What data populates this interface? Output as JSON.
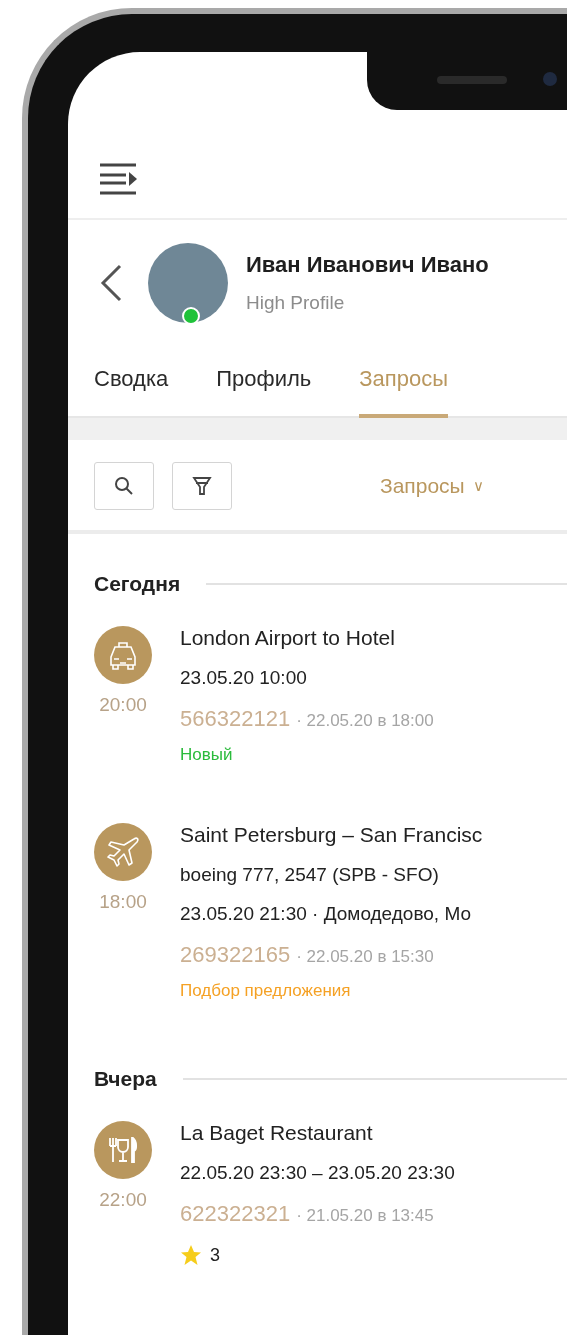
{
  "profile": {
    "name": "Иван Иванович Ивано",
    "subtitle": "High Profile",
    "online": true
  },
  "tabs": [
    {
      "label": "Сводка",
      "selected": false
    },
    {
      "label": "Профиль",
      "selected": false
    },
    {
      "label": "Запросы",
      "selected": true
    }
  ],
  "toolbar": {
    "filter_label": "Запросы",
    "caret": "∨"
  },
  "sections": [
    {
      "title": "Сегодня",
      "items": [
        {
          "kind": "taxi",
          "time": "20:00",
          "title": "London Airport to Hotel",
          "details": [
            "23.05.20  10:00"
          ],
          "number": "566322121",
          "created": "· 22.05.20 в 18:00",
          "status": {
            "label": "Новый",
            "color": "#2bbb3c"
          }
        },
        {
          "kind": "flight",
          "time": "18:00",
          "title": "Saint Petersburg – San Francisc",
          "details": [
            "boeing 777, 2547 (SPB - SFO)",
            "23.05.20  21:30 · Домодедово, Мо"
          ],
          "number": "269322165",
          "created": "· 22.05.20 в 15:30",
          "status": {
            "label": "Подбор предложения",
            "color": "#f5a124"
          }
        }
      ]
    },
    {
      "title": "Вчера",
      "items": [
        {
          "kind": "restaurant",
          "time": "22:00",
          "title": "La Baget Restaurant",
          "details": [
            "22.05.20  23:30 – 23.05.20  23:30"
          ],
          "number": "622322321",
          "created": "· 21.05.20 в 13:45",
          "rating": "3"
        }
      ]
    }
  ]
}
